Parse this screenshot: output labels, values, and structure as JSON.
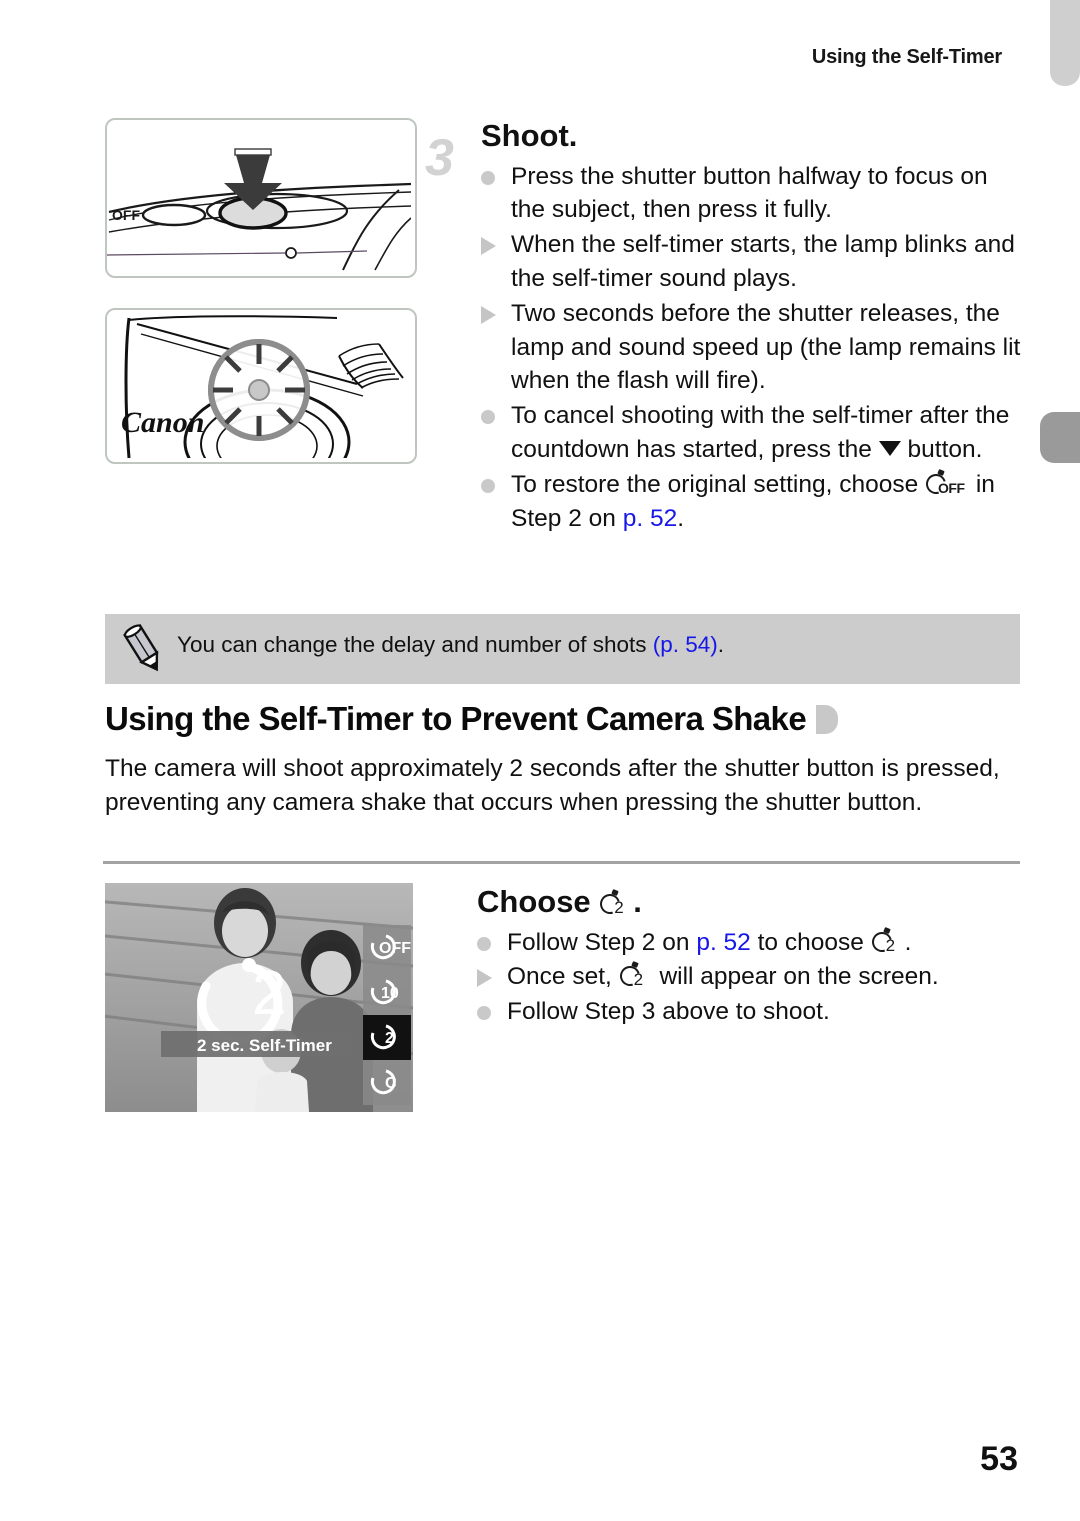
{
  "header": {
    "running_title": "Using the Self-Timer"
  },
  "step3": {
    "number": "3",
    "title": "Shoot.",
    "bullets": [
      {
        "marker": "dot",
        "text": "Press the shutter button halfway to focus on the subject, then press it fully."
      },
      {
        "marker": "tri",
        "text": "When the self-timer starts, the lamp blinks and the self-timer sound plays."
      },
      {
        "marker": "tri",
        "text": "Two seconds before the shutter releases, the lamp and sound speed up (the lamp remains lit when the flash will fire)."
      },
      {
        "marker": "dot",
        "text_before": "To cancel shooting with the self-timer after the countdown has started, press the ",
        "icon": "down-arrow-button-icon",
        "text_after": " button."
      },
      {
        "marker": "dot",
        "text_before": "To restore the original setting, choose ",
        "icon": "self-timer-off-icon",
        "icon_label": "OFF",
        "text_mid": " in Step 2 on ",
        "link": "p. 52",
        "text_after": "."
      }
    ]
  },
  "note": {
    "icon": "pencil-icon",
    "text_before": "You can change the delay and number of shots ",
    "link": "(p. 54)",
    "text_after": "."
  },
  "section": {
    "heading": "Using the Self-Timer to Prevent Camera Shake",
    "body": "The camera will shoot approximately 2 seconds after the shutter button is pressed, preventing any camera shake that occurs when pressing the shutter button."
  },
  "choose": {
    "title_before": "Choose ",
    "title_icon_label": "2",
    "title_after": ".",
    "bullets": [
      {
        "marker": "dot",
        "text_before": "Follow Step 2 on ",
        "link": "p. 52",
        "text_mid": " to choose ",
        "icon_label": "2",
        "text_after": "."
      },
      {
        "marker": "tri",
        "text_before": "Once set, ",
        "icon_label": "2",
        "text_after": " will appear on the screen."
      },
      {
        "marker": "dot",
        "text_before": "Follow Step 3 above to shoot.",
        "text_after": ""
      }
    ]
  },
  "figures": {
    "shutter_figure": {
      "name": "camera-top-shutter-button-illustration",
      "power_label": "OFF"
    },
    "lamp_figure": {
      "name": "camera-front-self-timer-lamp-illustration",
      "brand": "Canon"
    },
    "screen_figure": {
      "name": "camera-screen-self-timer-menu",
      "countdown_value": "2",
      "status_label": "2 sec. Self-Timer",
      "menu_items": [
        {
          "label": "OFF",
          "selected": false
        },
        {
          "label": "10",
          "selected": false
        },
        {
          "label": "2",
          "selected": true
        },
        {
          "label": "C",
          "selected": false
        }
      ]
    }
  },
  "footer": {
    "page_number": "53"
  },
  "colors": {
    "link": "#1717e8",
    "note_bg": "#cccccc",
    "marker_gray": "#c9c9c9",
    "tab_gray": "#9a9a9a"
  }
}
